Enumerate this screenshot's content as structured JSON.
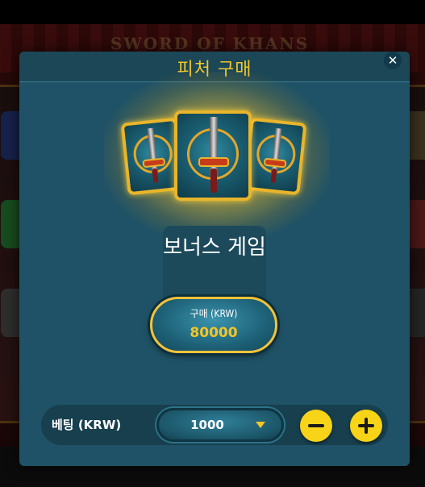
{
  "background": {
    "logo_text": "SWORD OF KHANS"
  },
  "modal": {
    "title": "피처 구매",
    "close_icon": "close-icon",
    "bonus_label": "보너스 게임",
    "buy_caption": "구매 (KRW)",
    "buy_price": "80000",
    "bet_label": "베팅 (KRW)",
    "bet_value": "1000",
    "accent_color": "#f2c52a",
    "panel_color": "#1f5266"
  }
}
